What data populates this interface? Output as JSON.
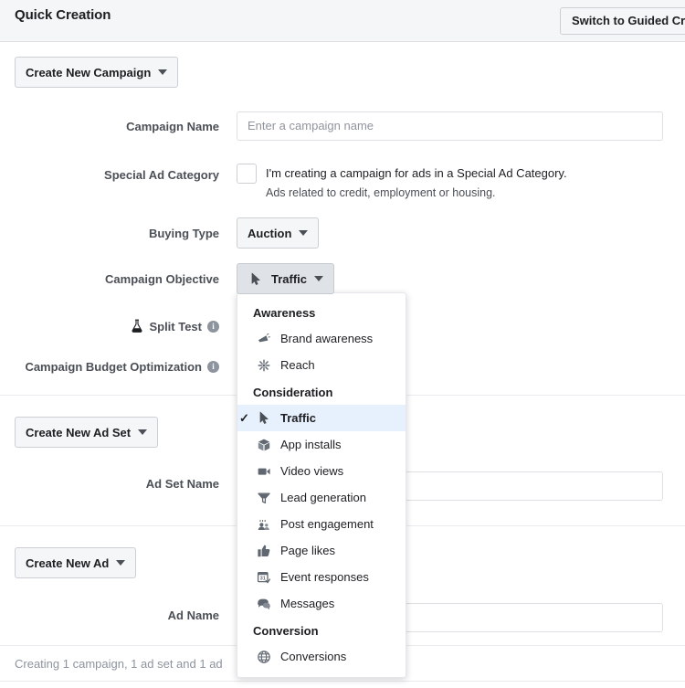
{
  "header": {
    "title": "Quick Creation",
    "switch_button": "Switch to Guided Cre"
  },
  "campaign_section": {
    "create_button": "Create New Campaign",
    "rows": {
      "campaign_name_label": "Campaign Name",
      "campaign_name_placeholder": "Enter a campaign name",
      "campaign_name_value": "",
      "special_ad_category_label": "Special Ad Category",
      "special_ad_category_checkbox_text": "I'm creating a campaign for ads in a Special Ad Category.",
      "special_ad_category_sub_text": "Ads related to credit, employment or housing.",
      "buying_type_label": "Buying Type",
      "buying_type_value": "Auction",
      "campaign_objective_label": "Campaign Objective",
      "campaign_objective_value": "Traffic",
      "split_test_label": "Split Test",
      "campaign_budget_optimization_label": "Campaign Budget Optimization"
    }
  },
  "adset_section": {
    "create_button": "Create New Ad Set",
    "adset_name_label": "Ad Set Name",
    "adset_name_value": ""
  },
  "ad_section": {
    "create_button": "Create New Ad",
    "ad_name_label": "Ad Name",
    "ad_name_value": ""
  },
  "objective_menu": {
    "groups": [
      {
        "title": "Awareness",
        "items": [
          {
            "label": "Brand awareness",
            "icon": "megaphone-icon",
            "selected": false
          },
          {
            "label": "Reach",
            "icon": "reach-burst-icon",
            "selected": false
          }
        ]
      },
      {
        "title": "Consideration",
        "items": [
          {
            "label": "Traffic",
            "icon": "cursor-pointer-icon",
            "selected": true
          },
          {
            "label": "App installs",
            "icon": "box-icon",
            "selected": false
          },
          {
            "label": "Video views",
            "icon": "video-camera-icon",
            "selected": false
          },
          {
            "label": "Lead generation",
            "icon": "funnel-icon",
            "selected": false
          },
          {
            "label": "Post engagement",
            "icon": "people-icon",
            "selected": false
          },
          {
            "label": "Page likes",
            "icon": "thumbs-up-icon",
            "selected": false
          },
          {
            "label": "Event responses",
            "icon": "calendar-check-icon",
            "selected": false
          },
          {
            "label": "Messages",
            "icon": "chat-bubbles-icon",
            "selected": false
          }
        ]
      },
      {
        "title": "Conversion",
        "items": [
          {
            "label": "Conversions",
            "icon": "globe-icon",
            "selected": false
          }
        ]
      }
    ]
  },
  "footer": {
    "status": "Creating 1 campaign, 1 ad set and 1 ad"
  },
  "colors": {
    "accent_selected_row": "#e7f0fd",
    "header_bg": "#f5f6f7",
    "border": "#dddfe2",
    "text_primary": "#1c1e21",
    "text_secondary": "#4b4f56",
    "text_muted": "#8d949e"
  }
}
